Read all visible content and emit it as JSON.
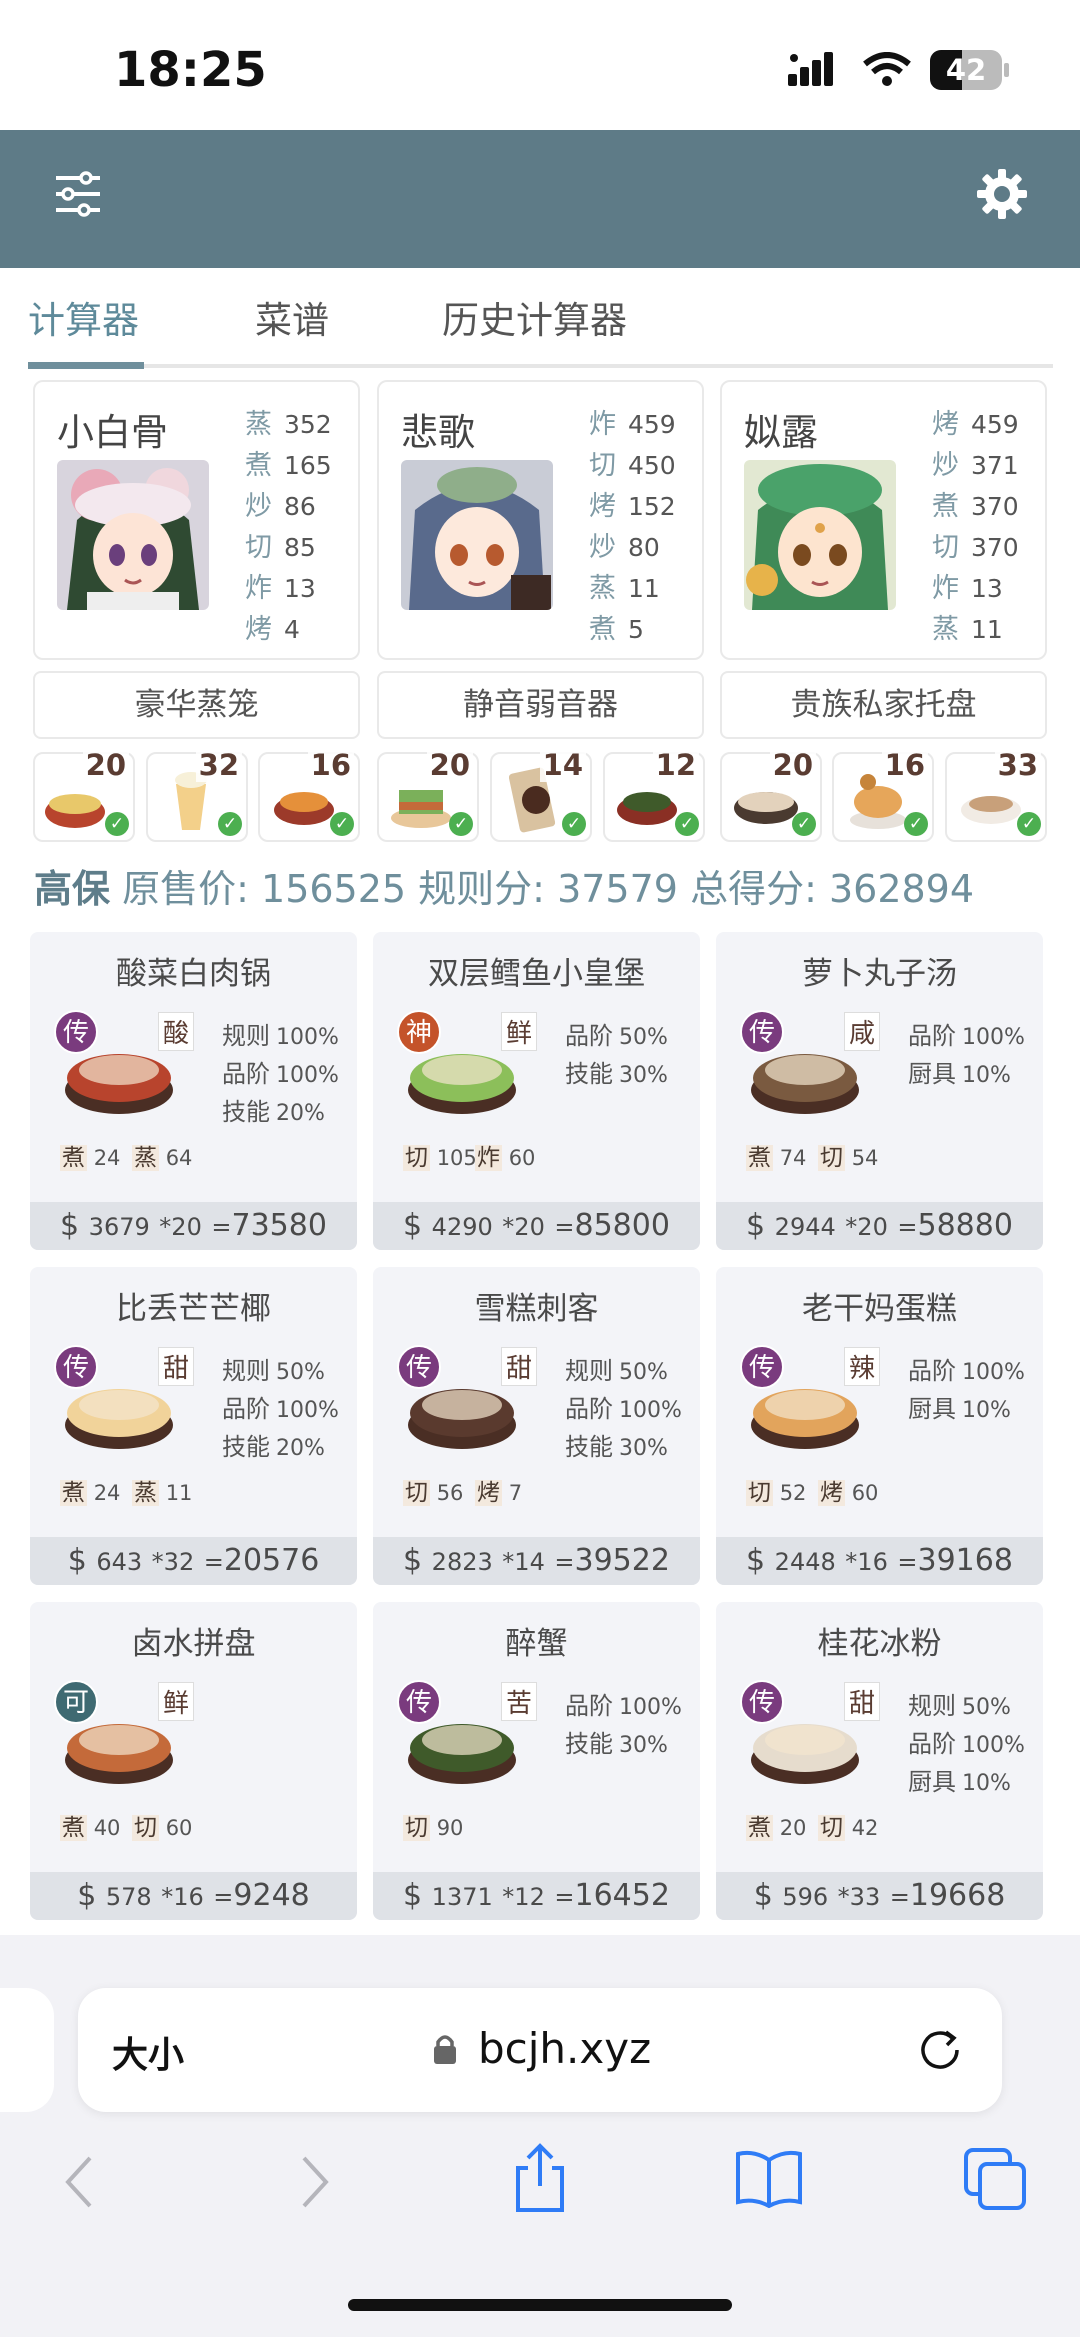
{
  "status_bar": {
    "time": "18:25",
    "battery": "42"
  },
  "header": {
    "filter_icon": "sliders-icon",
    "settings_icon": "gear-icon"
  },
  "tabs": [
    {
      "label": "计算器",
      "active": true
    },
    {
      "label": "菜谱",
      "active": false
    },
    {
      "label": "历史计算器",
      "active": false
    }
  ],
  "chefs": [
    {
      "name": "小白骨",
      "stats": [
        {
          "k": "蒸",
          "v": "352"
        },
        {
          "k": "煮",
          "v": "165"
        },
        {
          "k": "炒",
          "v": "86"
        },
        {
          "k": "切",
          "v": "85"
        },
        {
          "k": "炸",
          "v": "13"
        },
        {
          "k": "烤",
          "v": "4"
        }
      ],
      "equip": "豪华蒸笼"
    },
    {
      "name": "悲歌",
      "stats": [
        {
          "k": "炸",
          "v": "459"
        },
        {
          "k": "切",
          "v": "450"
        },
        {
          "k": "烤",
          "v": "152"
        },
        {
          "k": "炒",
          "v": "80"
        },
        {
          "k": "蒸",
          "v": "11"
        },
        {
          "k": "煮",
          "v": "5"
        }
      ],
      "equip": "静音弱音器"
    },
    {
      "name": "姒露",
      "stats": [
        {
          "k": "烤",
          "v": "459"
        },
        {
          "k": "炒",
          "v": "371"
        },
        {
          "k": "煮",
          "v": "370"
        },
        {
          "k": "切",
          "v": "370"
        },
        {
          "k": "炸",
          "v": "13"
        },
        {
          "k": "蒸",
          "v": "11"
        }
      ],
      "equip": "贵族私家托盘"
    }
  ],
  "ingredients": [
    "20",
    "32",
    "16",
    "20",
    "14",
    "12",
    "20",
    "16",
    "33"
  ],
  "summary": {
    "label_a": "高保",
    "label_b": "原售价:",
    "orig": "156525",
    "label_c": "规则分:",
    "rule": "37579",
    "label_d": "总得分:",
    "total": "362894"
  },
  "recipes": [
    {
      "name": "酸菜白肉锅",
      "rarity": "传",
      "flavor": "酸",
      "bonuses": [
        {
          "k": "规则",
          "v": "100%"
        },
        {
          "k": "品阶",
          "v": "100%"
        },
        {
          "k": "技能",
          "v": "20%"
        }
      ],
      "skills": [
        {
          "k": "煮",
          "v": "24"
        },
        {
          "k": "蒸",
          "v": "64"
        }
      ],
      "unit": "3679",
      "qty": "*20",
      "total": "73580"
    },
    {
      "name": "双层鳕鱼小皇堡",
      "rarity": "神",
      "flavor": "鲜",
      "bonuses": [
        {
          "k": "品阶",
          "v": "50%"
        },
        {
          "k": "技能",
          "v": "30%"
        }
      ],
      "skills": [
        {
          "k": "切",
          "v": "105"
        },
        {
          "k": "炸",
          "v": "60"
        }
      ],
      "unit": "4290",
      "qty": "*20",
      "total": "85800"
    },
    {
      "name": "萝卜丸子汤",
      "rarity": "传",
      "flavor": "咸",
      "bonuses": [
        {
          "k": "品阶",
          "v": "100%"
        },
        {
          "k": "厨具",
          "v": "10%"
        }
      ],
      "skills": [
        {
          "k": "煮",
          "v": "74"
        },
        {
          "k": "切",
          "v": "54"
        }
      ],
      "unit": "2944",
      "qty": "*20",
      "total": "58880"
    },
    {
      "name": "比丢芒芒椰",
      "rarity": "传",
      "flavor": "甜",
      "bonuses": [
        {
          "k": "规则",
          "v": "50%"
        },
        {
          "k": "品阶",
          "v": "100%"
        },
        {
          "k": "技能",
          "v": "20%"
        }
      ],
      "skills": [
        {
          "k": "煮",
          "v": "24"
        },
        {
          "k": "蒸",
          "v": "11"
        }
      ],
      "unit": "643",
      "qty": "*32",
      "total": "20576"
    },
    {
      "name": "雪糕刺客",
      "rarity": "传",
      "flavor": "甜",
      "bonuses": [
        {
          "k": "规则",
          "v": "50%"
        },
        {
          "k": "品阶",
          "v": "100%"
        },
        {
          "k": "技能",
          "v": "30%"
        }
      ],
      "skills": [
        {
          "k": "切",
          "v": "56"
        },
        {
          "k": "烤",
          "v": "7"
        }
      ],
      "unit": "2823",
      "qty": "*14",
      "total": "39522"
    },
    {
      "name": "老干妈蛋糕",
      "rarity": "传",
      "flavor": "辣",
      "bonuses": [
        {
          "k": "品阶",
          "v": "100%"
        },
        {
          "k": "厨具",
          "v": "10%"
        }
      ],
      "skills": [
        {
          "k": "切",
          "v": "52"
        },
        {
          "k": "烤",
          "v": "60"
        }
      ],
      "unit": "2448",
      "qty": "*16",
      "total": "39168"
    },
    {
      "name": "卤水拼盘",
      "rarity": "可",
      "flavor": "鲜",
      "bonuses": [],
      "skills": [
        {
          "k": "煮",
          "v": "40"
        },
        {
          "k": "切",
          "v": "60"
        }
      ],
      "unit": "578",
      "qty": "*16",
      "total": "9248"
    },
    {
      "name": "醉蟹",
      "rarity": "传",
      "flavor": "苦",
      "bonuses": [
        {
          "k": "品阶",
          "v": "100%"
        },
        {
          "k": "技能",
          "v": "30%"
        }
      ],
      "skills": [
        {
          "k": "切",
          "v": "90"
        }
      ],
      "unit": "1371",
      "qty": "*12",
      "total": "16452"
    },
    {
      "name": "桂花冰粉",
      "rarity": "传",
      "flavor": "甜",
      "bonuses": [
        {
          "k": "规则",
          "v": "50%"
        },
        {
          "k": "品阶",
          "v": "100%"
        },
        {
          "k": "厨具",
          "v": "10%"
        }
      ],
      "skills": [
        {
          "k": "煮",
          "v": "20"
        },
        {
          "k": "切",
          "v": "42"
        }
      ],
      "unit": "596",
      "qty": "*33",
      "total": "19668"
    }
  ],
  "browser": {
    "text_size": "大小",
    "url": "bcjh.xyz"
  }
}
